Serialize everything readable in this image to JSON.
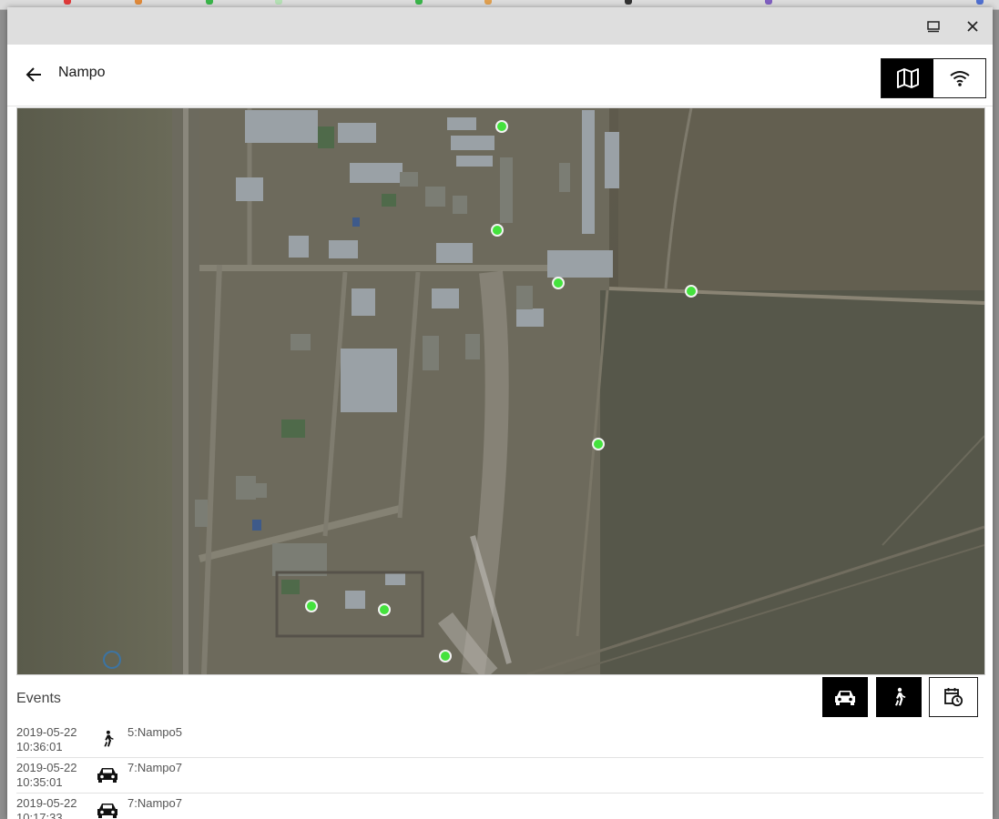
{
  "window": {
    "restore_icon": "restore-window-icon",
    "close_icon": "close-icon"
  },
  "header": {
    "back_icon": "arrow-left-icon",
    "title": "Nampo",
    "view_toggle": [
      {
        "icon": "map-icon",
        "active": true
      },
      {
        "icon": "wifi-icon",
        "active": false
      }
    ]
  },
  "map": {
    "type": "satellite",
    "marker_color": "#44e23d"
  },
  "events": {
    "label": "Events",
    "filters": [
      {
        "icon": "car-icon",
        "active": true
      },
      {
        "icon": "pedestrian-icon",
        "active": true
      },
      {
        "icon": "calendar-clock-icon",
        "active": false
      }
    ],
    "rows": [
      {
        "date": "2019-05-22",
        "time": "10:36:01",
        "icon": "pedestrian-icon",
        "name": "5:Nampo5"
      },
      {
        "date": "2019-05-22",
        "time": "10:35:01",
        "icon": "car-icon",
        "name": "7:Nampo7"
      },
      {
        "date": "2019-05-22",
        "time": "10:17:33",
        "icon": "car-icon",
        "name": "7:Nampo7"
      }
    ]
  },
  "colors": {
    "accent": "#000000",
    "window_titlebar": "#dedede",
    "marker": "#44e23d"
  }
}
